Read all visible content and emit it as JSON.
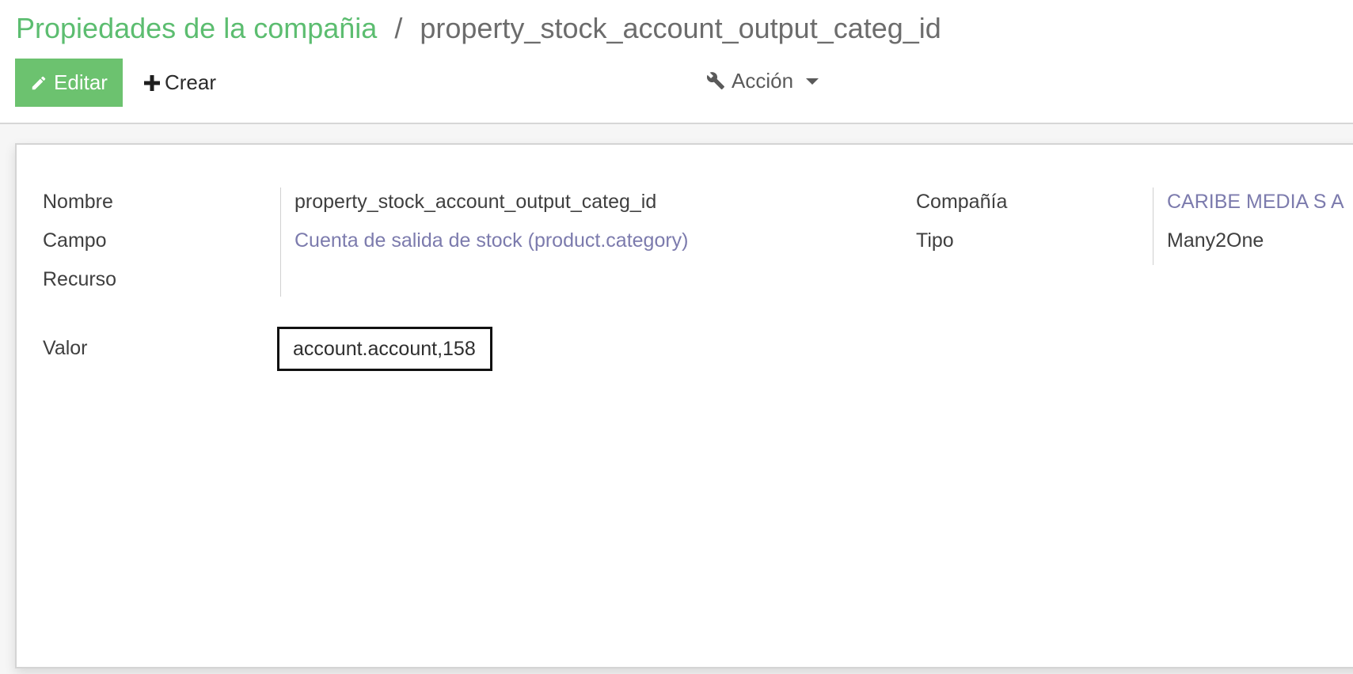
{
  "breadcrumb": {
    "parent": "Propiedades de la compañia",
    "separator": "/",
    "current": "property_stock_account_output_categ_id"
  },
  "toolbar": {
    "edit_label": "Editar",
    "create_label": "Crear",
    "action_label": "Acción"
  },
  "form": {
    "name_label": "Nombre",
    "name_value": "property_stock_account_output_categ_id",
    "field_label": "Campo",
    "field_value": "Cuenta de salida de stock (product.category)",
    "resource_label": "Recurso",
    "resource_value": "",
    "company_label": "Compañía",
    "company_value": "CARIBE MEDIA S A",
    "type_label": "Tipo",
    "type_value": "Many2One",
    "value_label": "Valor",
    "value_value": "account.account,158"
  },
  "colors": {
    "brand_green": "#5cbd70",
    "edit_button": "#6cc26f",
    "link": "#7c7bad"
  },
  "icons": {
    "edit": "pencil-icon",
    "create": "plus-icon",
    "action": "wrench-icon",
    "dropdown": "caret-down-icon"
  }
}
